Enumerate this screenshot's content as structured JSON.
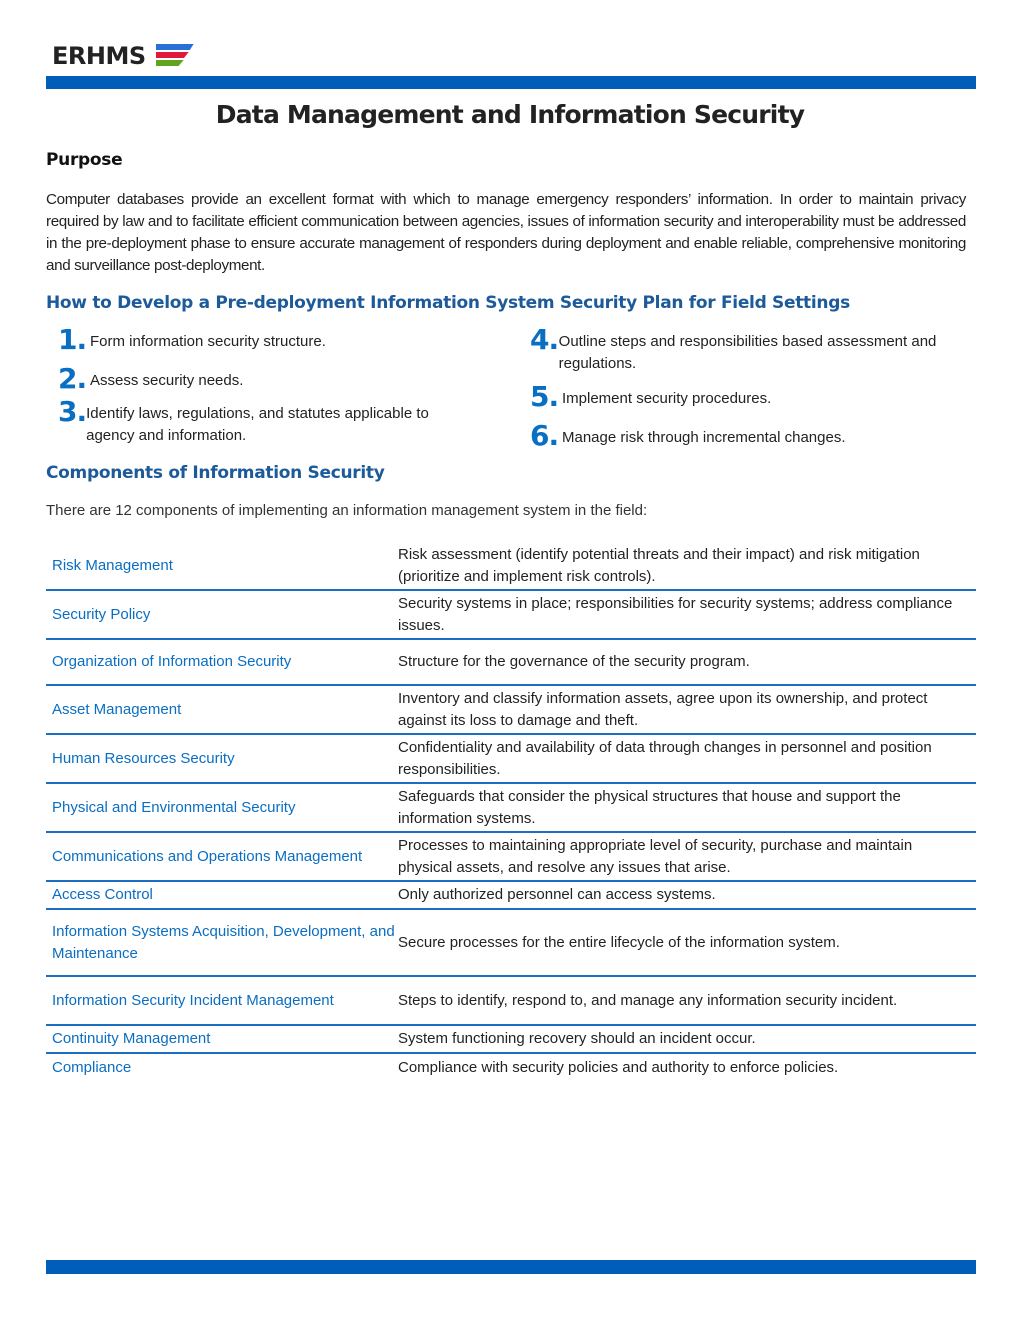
{
  "header": {
    "logo_text": "ERHMS",
    "logo_stripe_colors": [
      "#2a6fd6",
      "#e0193a",
      "#5fa31e"
    ],
    "brand_color": "#005eb8"
  },
  "title": "Data Management and Information Security",
  "purpose": {
    "heading": "Purpose",
    "text": "Computer databases provide an excellent format with which to manage emergency responders’ information. In order to maintain privacy required by law and to facilitate efficient communication between agencies, issues of information security and interoperability must be addressed in the pre-deployment phase to ensure accurate management of responders during deployment and enable reliable, comprehensive monitoring and surveillance post-deployment."
  },
  "steps": {
    "heading": "How to Develop a Pre-deployment Information System Security Plan for Field Settings",
    "items": [
      {
        "num": "1.",
        "text": "Form information security structure."
      },
      {
        "num": "2.",
        "text": "Assess security needs."
      },
      {
        "num": "3.",
        "text": "Identify laws, regulations, and statutes applicable to agency and information."
      },
      {
        "num": "4.",
        "text": "Outline steps and responsibilities based assessment and regulations."
      },
      {
        "num": "5.",
        "text": "Implement security procedures."
      },
      {
        "num": "6.",
        "text": "Manage risk through incremental changes."
      }
    ]
  },
  "components": {
    "heading": "Components of Information Security",
    "intro": "There are 12 components of implementing an information management system in the field:",
    "rows": [
      {
        "name": "Risk Management",
        "desc": "Risk assessment (identify potential threats and their impact) and risk mitigation (prioritize and implement risk controls)."
      },
      {
        "name": "Security Policy",
        "desc": "Security systems in place; responsibilities for security systems; address compliance issues."
      },
      {
        "name": "Organization of Information Security",
        "desc": "Structure for the governance of the security program."
      },
      {
        "name": "Asset Management",
        "desc": "Inventory and classify information assets, agree upon its ownership, and protect against its loss to damage and theft."
      },
      {
        "name": "Human Resources Security",
        "desc": "Confidentiality and availability of data through changes in personnel and position responsibilities."
      },
      {
        "name": "Physical and Environmental Security",
        "desc": "Safeguards that consider the physical structures that house and support the information systems."
      },
      {
        "name": "Communications and Operations Management",
        "desc": "Processes to maintaining appropriate level of security, purchase and maintain physical assets, and resolve any issues that arise."
      },
      {
        "name": "Access Control",
        "desc": "Only authorized personnel can access systems."
      },
      {
        "name": "Information Systems Acquisition, Development, and Maintenance",
        "desc": "Secure processes for the entire lifecycle of the information system."
      },
      {
        "name": "Information Security Incident Management",
        "desc": "Steps to identify, respond to, and manage any information security incident."
      },
      {
        "name": "Continuity Management",
        "desc": "System functioning recovery should an incident occur."
      },
      {
        "name": "Compliance",
        "desc": "Compliance with security policies and authority to enforce policies."
      }
    ]
  }
}
